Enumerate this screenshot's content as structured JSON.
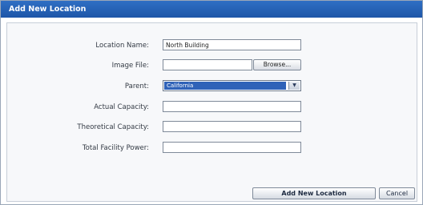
{
  "dialog": {
    "title": "Add New Location"
  },
  "form": {
    "location_name": {
      "label": "Location Name:",
      "value": "North Building"
    },
    "image_file": {
      "label": "Image File:",
      "value": "",
      "browse_label": "Browse..."
    },
    "parent": {
      "label": "Parent:",
      "selected": "California"
    },
    "actual_capacity": {
      "label": "Actual Capacity:",
      "value": ""
    },
    "theoretical_capacity": {
      "label": "Theoretical Capacity:",
      "value": ""
    },
    "total_facility_power": {
      "label": "Total Facility Power:",
      "value": ""
    }
  },
  "buttons": {
    "add_label": "Add New Location",
    "cancel_label": "Cancel"
  },
  "icons": {
    "select_arrow": "chevron-down-icon"
  }
}
